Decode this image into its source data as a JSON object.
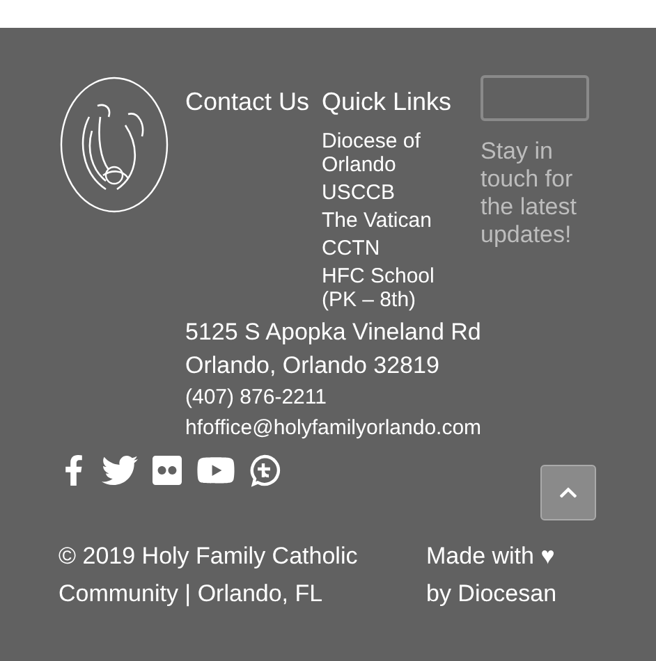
{
  "contact": {
    "heading": "Contact Us",
    "address_line_1": "5125 S Apopka Vineland Rd",
    "address_line_2": "Orlando, Orlando 32819",
    "phone": "(407) 876-2211",
    "email": "hfoffice@holyfamilyorlando.com"
  },
  "quick_links": {
    "heading": "Quick Links",
    "links": [
      "Diocese of Orlando",
      "USCCB",
      "The Vatican",
      "CCTN",
      "HFC School (PK – 8th)"
    ]
  },
  "newsletter": {
    "message": "Stay in touch for the latest updates!"
  },
  "social": [
    {
      "kind": "facebook"
    },
    {
      "kind": "twitter"
    },
    {
      "kind": "flickr"
    },
    {
      "kind": "youtube"
    },
    {
      "kind": "circle"
    }
  ],
  "copyright": "© 2019 Holy Family Catholic Community | Orlando, FL",
  "credit": "Made with ♥ by Diocesan"
}
